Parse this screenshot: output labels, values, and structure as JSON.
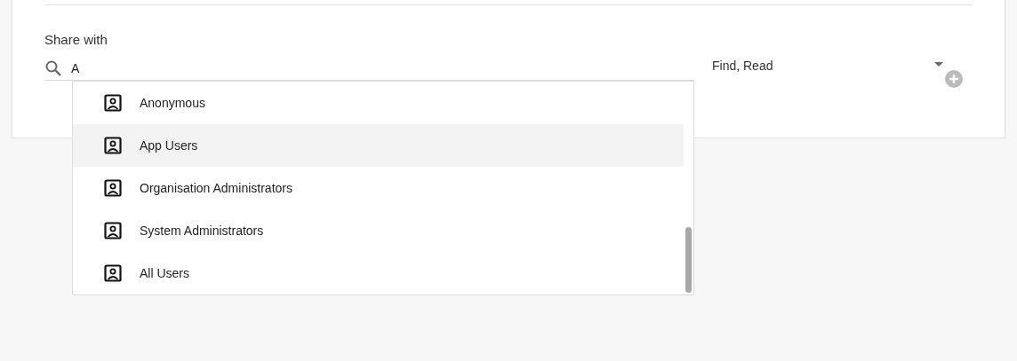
{
  "share_with": {
    "label": "Share with",
    "search_value": "A",
    "permission": "Find, Read",
    "options": [
      {
        "label": "Anonymous",
        "selected": false
      },
      {
        "label": "App Users",
        "selected": true
      },
      {
        "label": "Organisation Administrators",
        "selected": false
      },
      {
        "label": "System Administrators",
        "selected": false
      },
      {
        "label": "All Users",
        "selected": false
      }
    ]
  }
}
